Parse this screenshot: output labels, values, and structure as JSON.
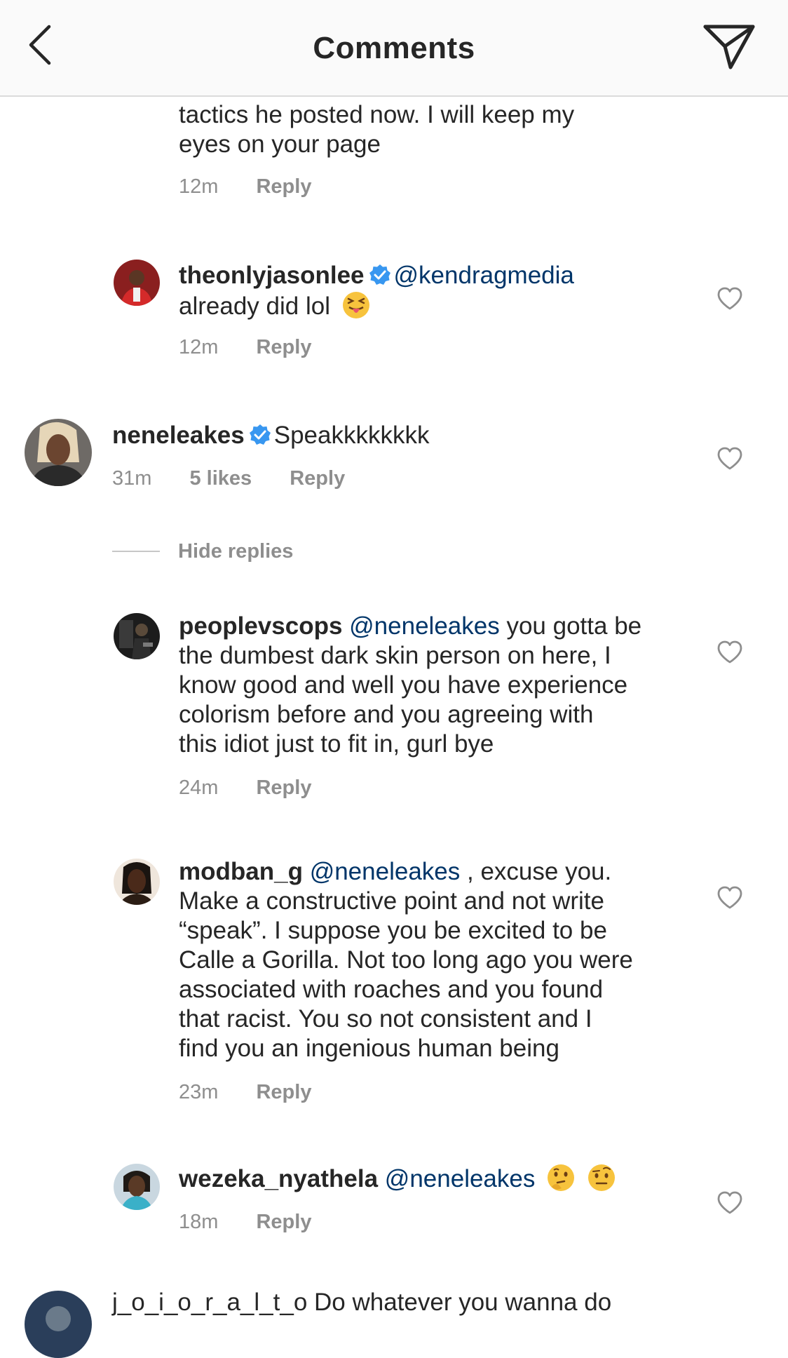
{
  "header": {
    "title": "Comments",
    "back_icon": "chevron-left-icon",
    "send_icon": "paper-plane-icon"
  },
  "comments": [
    {
      "text_lines": [
        "tactics he posted now. I will keep my",
        "eyes on your page"
      ],
      "time": "12m",
      "reply": "Reply"
    },
    {
      "username": "theonlyjasonlee",
      "verified": true,
      "mention": "@kendragmedia",
      "text": "already did lol",
      "emoji": "squinting-tongue-emoji",
      "time": "12m",
      "reply": "Reply"
    },
    {
      "username": "neneleakes",
      "verified": true,
      "text": "Speakkkkkkkk",
      "time": "31m",
      "likes": "5 likes",
      "reply": "Reply"
    },
    {
      "username": "peoplevscops",
      "mention": "@neneleakes",
      "text_first": "you gotta be",
      "text_lines": [
        "the dumbest dark skin person on here, I",
        "know good and well you have experience",
        "colorism before and you agreeing with",
        "this idiot just to fit in, gurl bye"
      ],
      "time": "24m",
      "reply": "Reply"
    },
    {
      "username": "modban_g",
      "mention": "@neneleakes",
      "text_first": ", excuse you.",
      "text_lines": [
        "Make a constructive point and not write",
        "“speak”. I suppose you be excited to be",
        "Calle a Gorilla. Not too long ago you were",
        "associated with roaches and you found",
        "that racist. You so not consistent and I",
        "find you an ingenious human being"
      ],
      "time": "23m",
      "reply": "Reply"
    },
    {
      "username": "wezeka_nyathela",
      "mention": "@neneleakes",
      "emojis": [
        "thinking-face-emoji",
        "raised-eyebrow-emoji"
      ],
      "time": "18m",
      "reply": "Reply"
    },
    {
      "partial_text": "j_o_i_o_r_a_l_t_o Do whatever you wanna do"
    }
  ],
  "hide_replies": "Hide replies",
  "colors": {
    "mention": "#003569",
    "verified": "#3897f0",
    "meta": "#8e8e8e",
    "text": "#262626"
  }
}
